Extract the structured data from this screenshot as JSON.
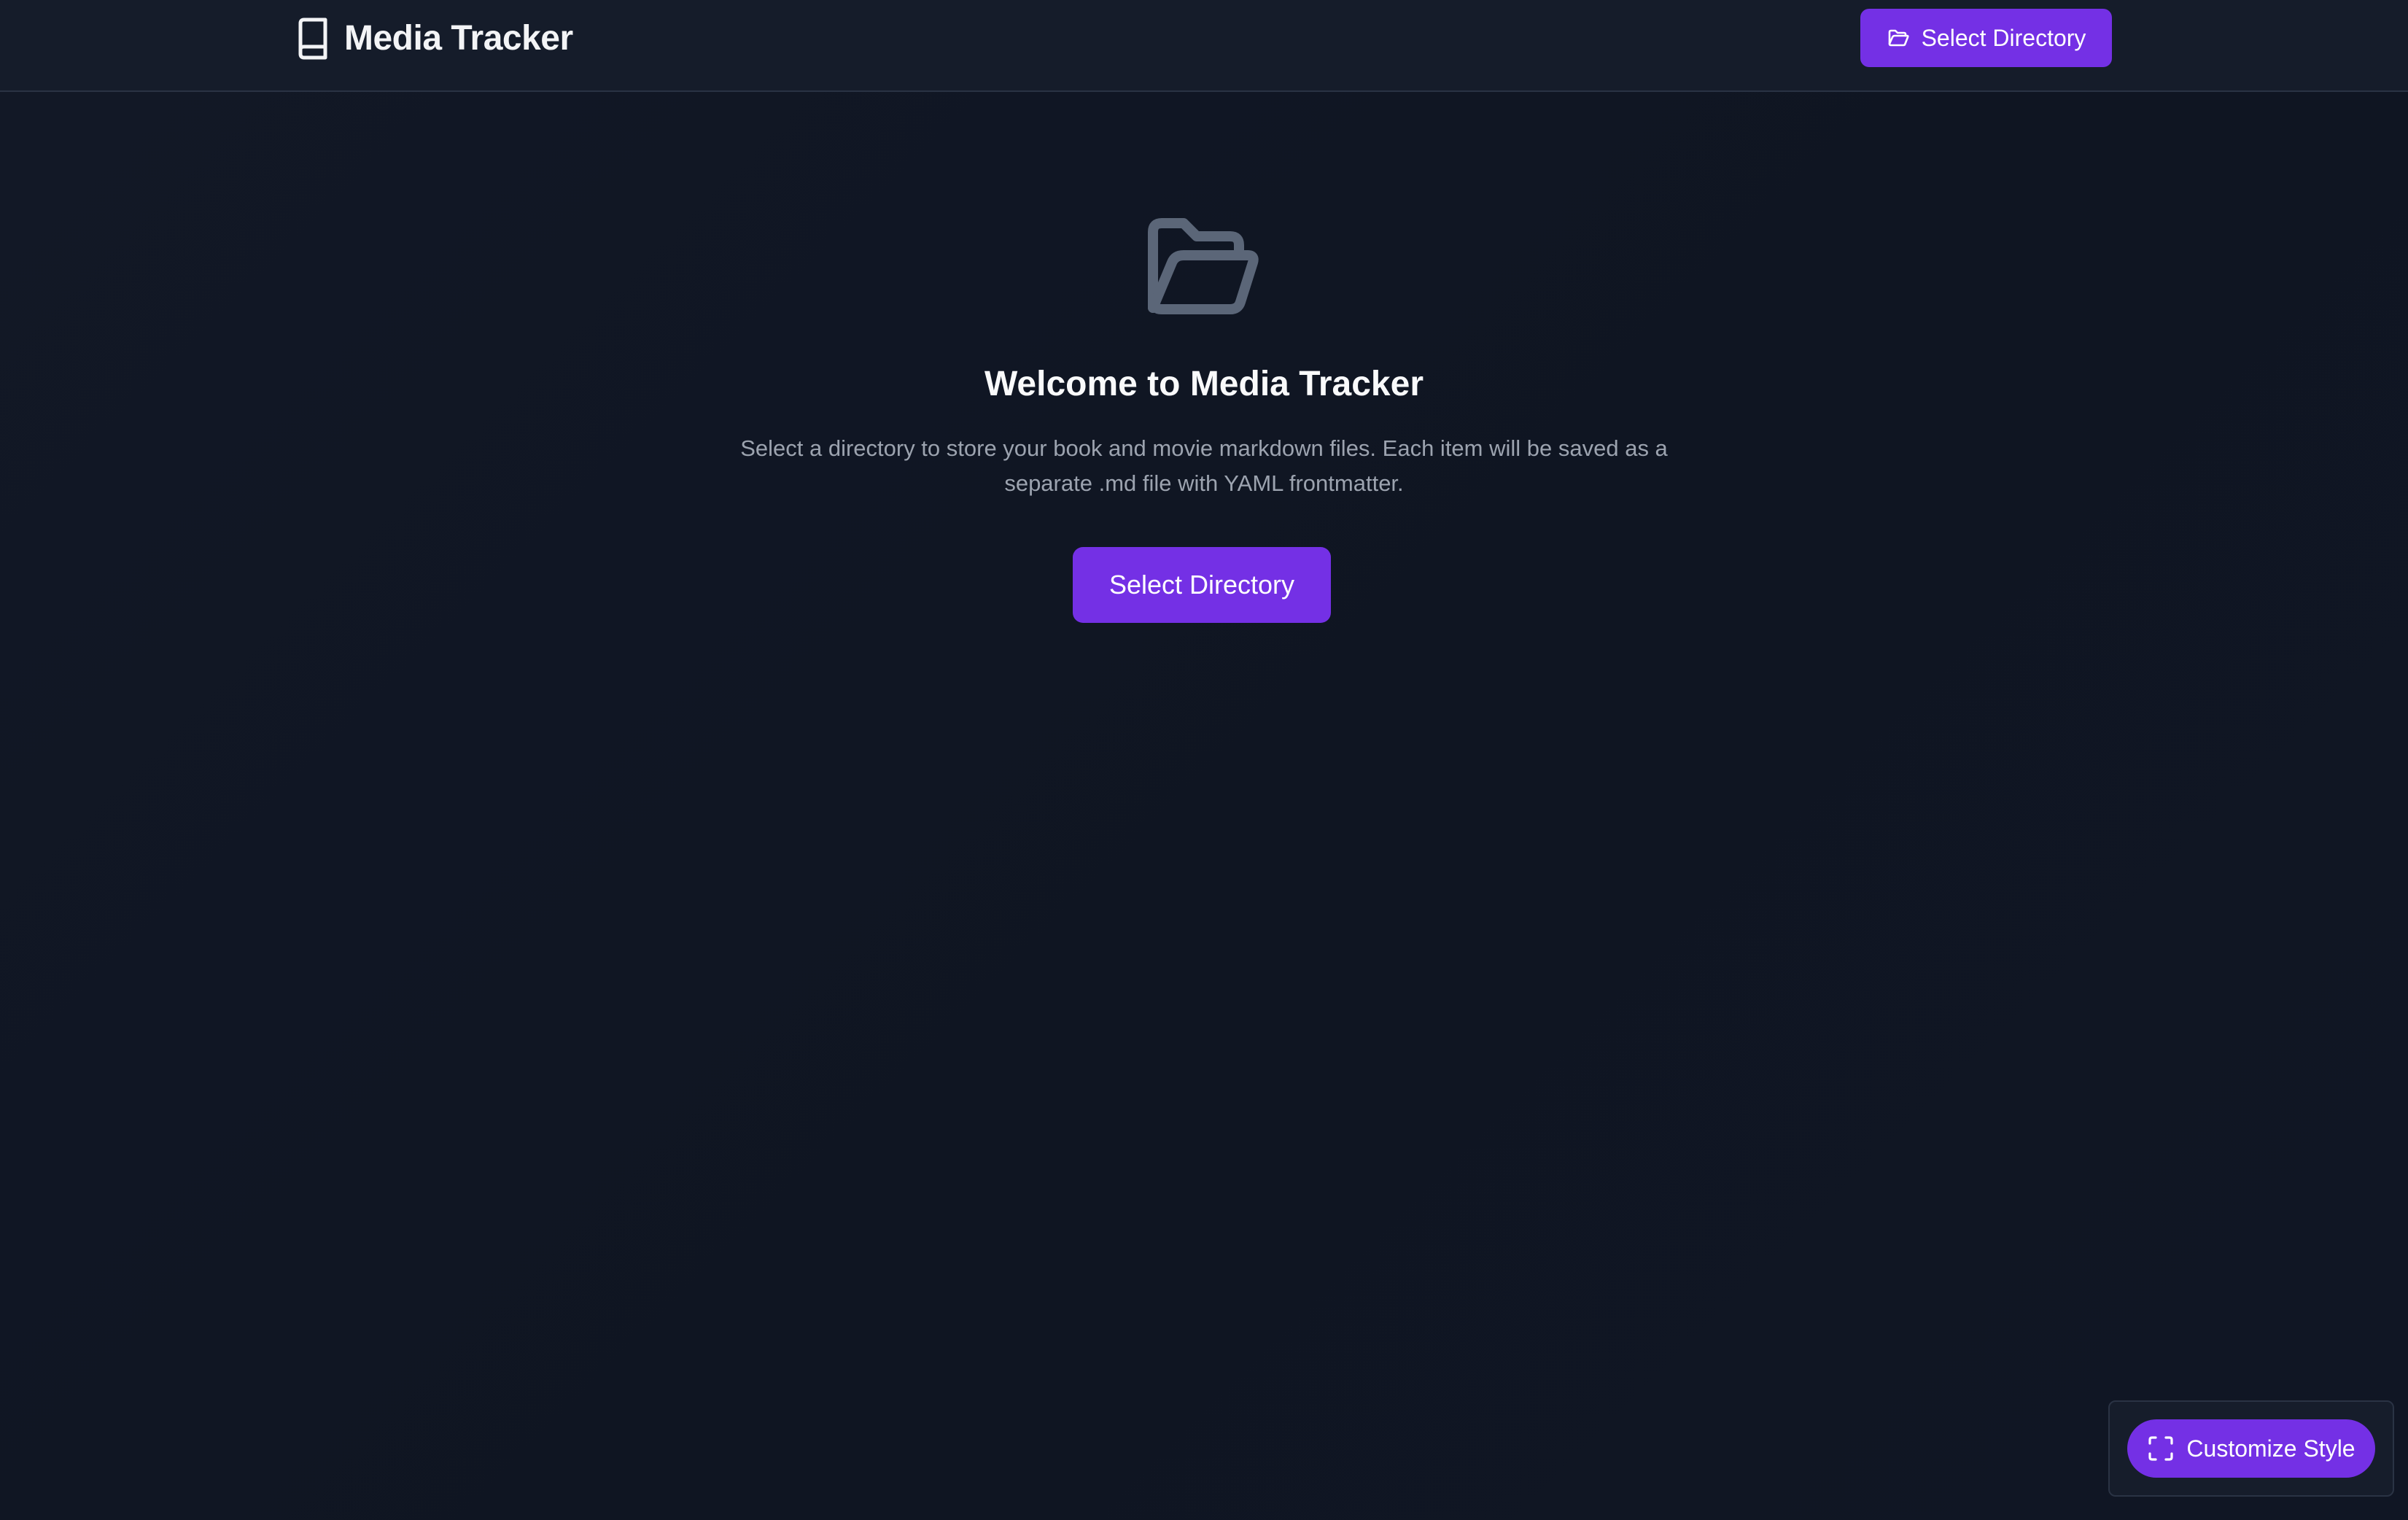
{
  "header": {
    "title": "Media Tracker",
    "logo_icon": "book-icon",
    "select_button": {
      "label": "Select Directory",
      "icon": "folder-open-icon"
    }
  },
  "main": {
    "icon": "folder-open-icon",
    "heading": "Welcome to Media Tracker",
    "description": "Select a directory to store your book and movie markdown files. Each item will be saved as a separate .md file with YAML frontmatter.",
    "button_label": "Select Directory"
  },
  "customize": {
    "label": "Customize Style",
    "icon": "expand-icon"
  },
  "colors": {
    "background": "#111827",
    "header_bg": "#151c2a",
    "accent": "#7430e5",
    "muted_text": "#9ca3af",
    "icon_gray": "#5b6678"
  }
}
